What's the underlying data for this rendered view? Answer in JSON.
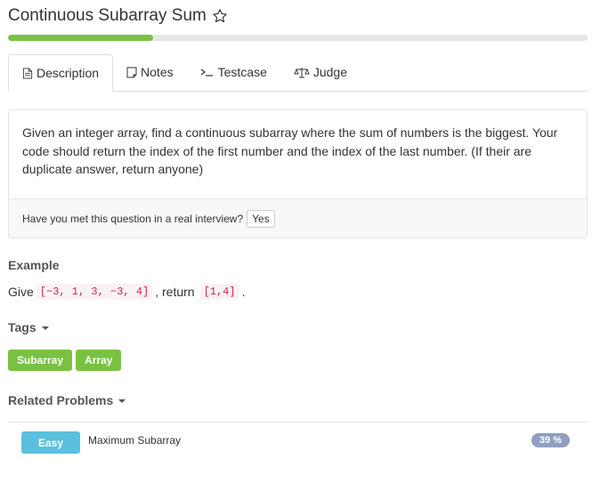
{
  "problem": {
    "title": "Continuous Subarray Sum",
    "progress_fraction": 0.25
  },
  "tabs": [
    {
      "label": "Description",
      "icon": "document-icon",
      "active": true
    },
    {
      "label": "Notes",
      "icon": "note-icon",
      "active": false
    },
    {
      "label": "Testcase",
      "icon": "terminal-icon",
      "active": false
    },
    {
      "label": "Judge",
      "icon": "scale-icon",
      "active": false
    }
  ],
  "description": {
    "text": "Given an integer array, find a continuous subarray where the sum of numbers is the biggest. Your code should return the index of the first number and the index of the last number. (If their are duplicate answer, return anyone)",
    "interview_question": "Have you met this question in a real interview?",
    "yes_label": "Yes"
  },
  "example": {
    "heading": "Example",
    "give": "Give",
    "input": "[−3, 1, 3, −3, 4]",
    "return_text": ", return",
    "output": "[1,4]",
    "period": "."
  },
  "tags": {
    "heading": "Tags",
    "items": [
      "Subarray",
      "Array"
    ]
  },
  "related": {
    "heading": "Related Problems",
    "items": [
      {
        "difficulty": "Easy",
        "name": "Maximum Subarray",
        "rate": "39 %"
      }
    ]
  },
  "colors": {
    "accent_green": "#7ac143",
    "easy_blue": "#5bc0de",
    "rate_badge": "#8f9fbf"
  }
}
